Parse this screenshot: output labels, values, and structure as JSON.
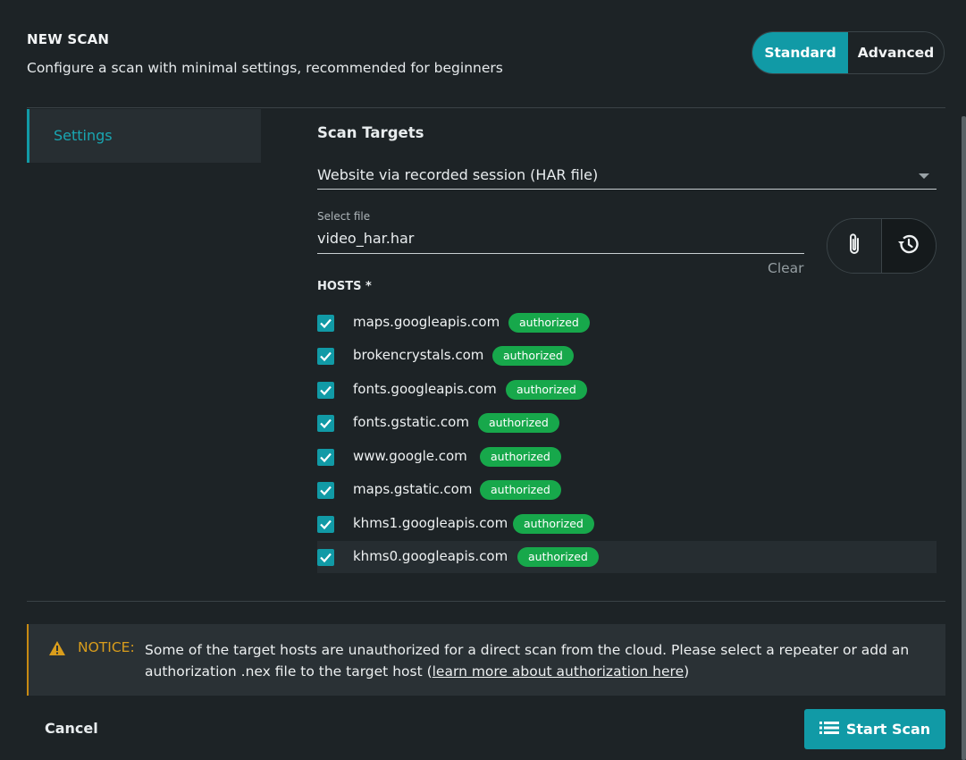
{
  "header": {
    "title": "NEW SCAN",
    "subtitle": "Configure a scan with minimal settings, recommended for beginners"
  },
  "mode_toggle": {
    "standard_label": "Standard",
    "advanced_label": "Advanced",
    "selected": "Standard"
  },
  "sidebar": {
    "items": [
      {
        "label": "Settings",
        "active": true
      }
    ]
  },
  "scan_targets": {
    "title": "Scan Targets",
    "target_type": "Website via recorded session (HAR file)",
    "file_label": "Select file",
    "file_value": "video_har.har",
    "clear_label": "Clear",
    "attach_icon": "paperclip-icon",
    "history_icon": "history-icon"
  },
  "hosts": {
    "title": "HOSTS *",
    "items": [
      {
        "name": "maps.googleapis.com",
        "status": "authorized",
        "checked": true
      },
      {
        "name": "brokencrystals.com",
        "status": "authorized",
        "checked": true
      },
      {
        "name": "fonts.googleapis.com",
        "status": "authorized",
        "checked": true
      },
      {
        "name": "fonts.gstatic.com",
        "status": "authorized",
        "checked": true
      },
      {
        "name": "www.google.com",
        "status": "authorized",
        "checked": true
      },
      {
        "name": "maps.gstatic.com",
        "status": "authorized",
        "checked": true
      },
      {
        "name": "khms1.googleapis.com",
        "status": "authorized",
        "checked": true
      },
      {
        "name": "khms0.googleapis.com",
        "status": "authorized",
        "checked": true
      }
    ]
  },
  "notice": {
    "label": "NOTICE:",
    "text": "Some of the target hosts are unauthorized for a direct scan from the cloud. Please select a repeater or add an authorization .nex file to the target host (",
    "link": "learn more about authorization here",
    "text_end": ")"
  },
  "footer": {
    "cancel_label": "Cancel",
    "start_label": "Start Scan"
  },
  "colors": {
    "accent": "#119aa6",
    "badge": "#17a84b",
    "warning": "#d99d1c",
    "background": "#1d2326"
  }
}
